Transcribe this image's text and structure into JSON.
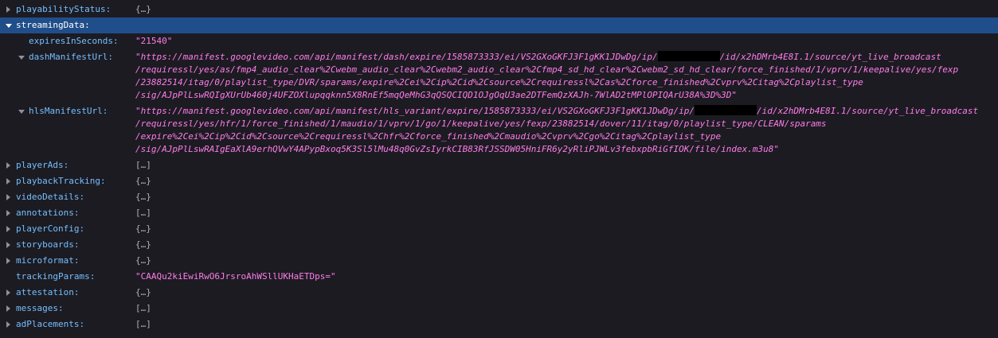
{
  "rows": {
    "playabilityStatus": {
      "key": "playabilityStatus:",
      "value": "{…}"
    },
    "streamingData": {
      "key": "streamingData:"
    },
    "expiresInSeconds": {
      "key": "expiresInSeconds:",
      "value": "\"21540\""
    },
    "dashManifestUrl": {
      "key": "dashManifestUrl:",
      "line1a": "\"https://manifest.googlevideo.com/api/manifest/dash/expire/1585873333/ei/VS2GXoGKFJ3F1gKK1JDwDg/ip/",
      "line1b": "/id/x2hDMrb4E8I.1/source/yt_live_broadcast",
      "line2": "/requiressl/yes/as/fmp4_audio_clear%2Cwebm_audio_clear%2Cwebm2_audio_clear%2Cfmp4_sd_hd_clear%2Cwebm2_sd_hd_clear/force_finished/1/vprv/1/keepalive/yes/fexp",
      "line3": "/23882514/itag/0/playlist_type/DVR/sparams/expire%2Cei%2Cip%2Cid%2Csource%2Crequiressl%2Cas%2Cforce_finished%2Cvprv%2Citag%2Cplaylist_type",
      "line4": "/sig/AJpPlLswRQIgXUrUb460j4UFZOXlupqqknn5X8RnEf5mqQeMhG3qQSQCIQD1OJgOqU3ae2DTFemQzXAJh-7WlAD2tMPlOPIQArU38A%3D%3D\""
    },
    "hlsManifestUrl": {
      "key": "hlsManifestUrl:",
      "line1a": "\"https://manifest.googlevideo.com/api/manifest/hls_variant/expire/1585873333/ei/VS2GXoGKFJ3F1gKK1JDwDg/ip/",
      "line1b": "/id/x2hDMrb4E8I.1/source/yt_live_broadcast",
      "line2": "/requiressl/yes/hfr/1/force_finished/1/maudio/1/vprv/1/go/1/keepalive/yes/fexp/23882514/dover/11/itag/0/playlist_type/CLEAN/sparams",
      "line3": "/expire%2Cei%2Cip%2Cid%2Csource%2Crequiressl%2Chfr%2Cforce_finished%2Cmaudio%2Cvprv%2Cgo%2Citag%2Cplaylist_type",
      "line4": "/sig/AJpPlLswRAIgEaXlA9erhQVwY4APypBxoq5K3Sl5lMu48q0GvZsIyrkCIB83RfJSSDW05HniFR6y2yRliPJWLv3febxpbRiGfIOK/file/index.m3u8\""
    },
    "playerAds": {
      "key": "playerAds:",
      "value": "[…]"
    },
    "playbackTracking": {
      "key": "playbackTracking:",
      "value": "{…}"
    },
    "videoDetails": {
      "key": "videoDetails:",
      "value": "{…}"
    },
    "annotations": {
      "key": "annotations:",
      "value": "[…]"
    },
    "playerConfig": {
      "key": "playerConfig:",
      "value": "{…}"
    },
    "storyboards": {
      "key": "storyboards:",
      "value": "{…}"
    },
    "microformat": {
      "key": "microformat:",
      "value": "{…}"
    },
    "trackingParams": {
      "key": "trackingParams:",
      "value": "\"CAAQu2kiEwiRwO6JrsroAhWSllUKHaETDps=\""
    },
    "attestation": {
      "key": "attestation:",
      "value": "{…}"
    },
    "messages": {
      "key": "messages:",
      "value": "[…]"
    },
    "adPlacements": {
      "key": "adPlacements:",
      "value": "[…]"
    }
  },
  "colors": {
    "background": "#1c1b22",
    "selected_row": "#204e8a",
    "key": "#75bfff",
    "string_value": "#ff7de9",
    "object_value": "#b1b1b3",
    "redaction": "#000000"
  },
  "icons": {
    "collapsed": "triangle-right-icon",
    "expanded": "triangle-down-icon"
  }
}
